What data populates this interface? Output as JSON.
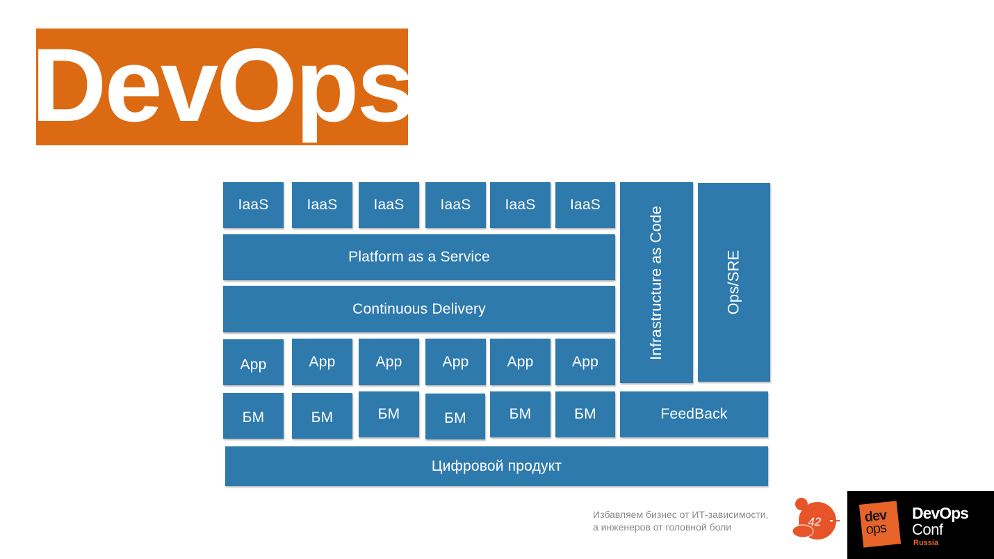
{
  "title": "DevOps",
  "diagram": {
    "iaas": [
      "IaaS",
      "IaaS",
      "IaaS",
      "IaaS",
      "IaaS",
      "IaaS"
    ],
    "paas": "Platform as a Service",
    "cd": "Continuous Delivery",
    "apps": [
      "App",
      "App",
      "App",
      "App",
      "App",
      "App"
    ],
    "bm": [
      "БМ",
      "БМ",
      "БМ",
      "БМ",
      "БМ",
      "БМ"
    ],
    "iac": "Infrastructure as Code",
    "ops": "Ops/SRE",
    "feedback": "FeedBack",
    "product": "Цифровой продукт",
    "block_color": "#2f7aad"
  },
  "footer": {
    "tagline_line1": "Избавляем бизнес от ИТ-зависимости,",
    "tagline_line2": "а инженеров от головной боли",
    "page_number": "42",
    "conf_logo": {
      "dev": "dev",
      "ops": "ops",
      "name": "DevOps",
      "conf": "Conf",
      "country": "Russia"
    },
    "accent_color": "#e8642a"
  },
  "title_color": "#dc6a12"
}
